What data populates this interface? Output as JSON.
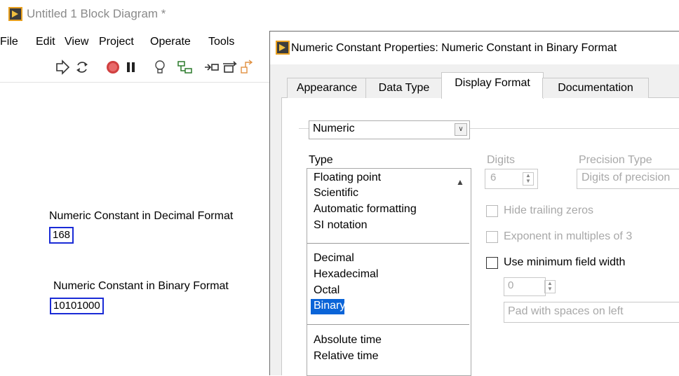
{
  "block_diagram": {
    "title": "Untitled 1 Block Diagram *",
    "menu": [
      "File",
      "Edit",
      "View",
      "Project",
      "Operate",
      "Tools"
    ],
    "toolbar_icons": [
      "run-arrow-icon",
      "run-continuously-icon",
      "abort-icon",
      "pause-icon",
      "highlight-execution-icon",
      "retain-wire-values-icon",
      "step-into-icon",
      "step-over-icon",
      "step-out-icon"
    ],
    "decimal_label": "Numeric Constant in Decimal Format",
    "decimal_value": "168",
    "binary_label": "Numeric Constant in Binary Format",
    "binary_value": "10101000"
  },
  "dialog": {
    "title": "Numeric Constant Properties: Numeric Constant in Binary Format",
    "tabs": [
      "Appearance",
      "Data Type",
      "Display Format",
      "Documentation"
    ],
    "active_tab": "Display Format",
    "format_select": "Numeric",
    "type_label": "Type",
    "type_groups": [
      [
        "Floating point",
        "Scientific",
        "Automatic formatting",
        "SI notation"
      ],
      [
        "Decimal",
        "Hexadecimal",
        "Octal",
        "Binary"
      ],
      [
        "Absolute time",
        "Relative time"
      ]
    ],
    "selected_type": "Binary",
    "digits_label": "Digits",
    "digits_value": "6",
    "precision_label": "Precision Type",
    "precision_value": "Digits of precision",
    "hide_trailing_zeros": "Hide trailing zeros",
    "exponent_multiples": "Exponent in multiples of 3",
    "use_min_width": "Use minimum field width",
    "min_width_value": "0",
    "pad_value": "Pad with spaces on left"
  },
  "colors": {
    "constant_border": "#1a2bd6",
    "selection": "#0a64d8"
  }
}
